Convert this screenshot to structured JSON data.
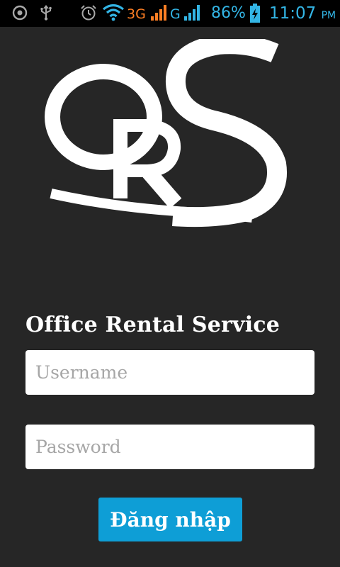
{
  "status_bar": {
    "icons_left": [
      "target-icon",
      "usb-icon"
    ],
    "icons_right": [
      "alarm-icon",
      "wifi-icon",
      "signal-icon",
      "signal-icon",
      "battery-charging-icon"
    ],
    "network_1": "3G",
    "network_2": "G",
    "battery_percent": "86%",
    "time": "11:07",
    "ampm": "PM",
    "colors": {
      "accent": "#33b5e5",
      "network_3g": "#ff7f24"
    }
  },
  "logo": {
    "letters": "ORS"
  },
  "login": {
    "title": "Office Rental Service",
    "username_placeholder": "Username",
    "password_placeholder": "Password",
    "submit_label": "Đăng nhập"
  },
  "colors": {
    "background": "#262626",
    "button": "#0e9ed6",
    "field": "#ffffff"
  }
}
